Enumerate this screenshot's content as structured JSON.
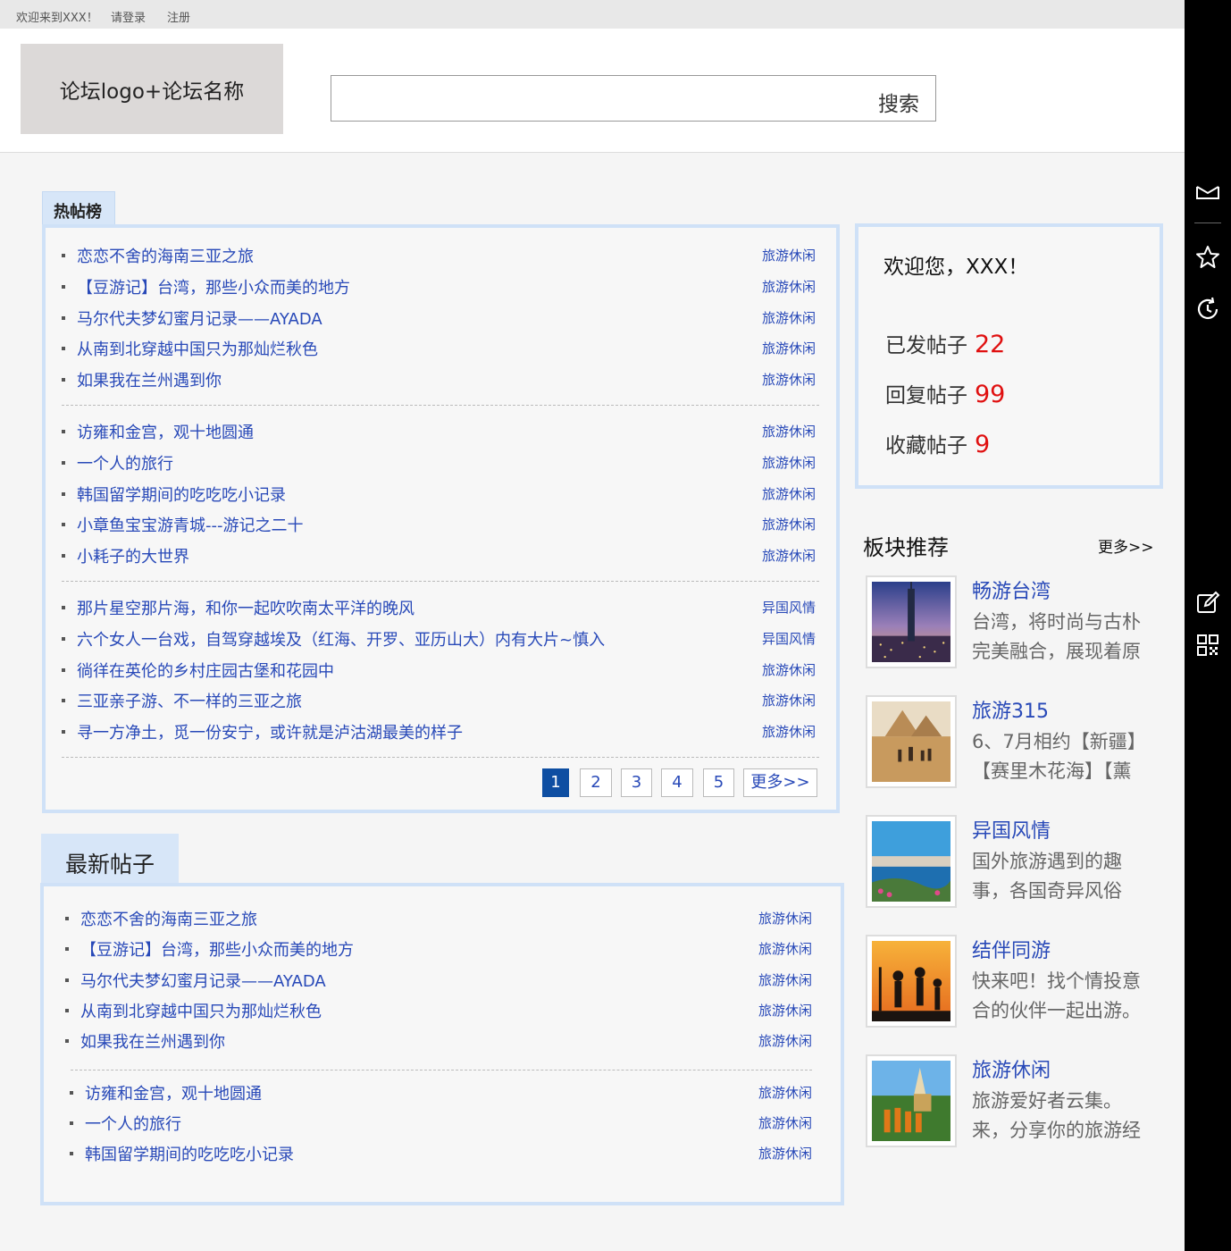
{
  "topbar": {
    "welcome": "欢迎来到XXX！",
    "login": "请登录",
    "register": "注册"
  },
  "header": {
    "logo_text": "论坛logo+论坛名称",
    "search_button": "搜索"
  },
  "hot": {
    "tab": "热帖榜",
    "groups": [
      [
        {
          "title": "恋恋不舍的海南三亚之旅",
          "tag": "旅游休闲"
        },
        {
          "title": "【豆游记】台湾，那些小众而美的地方",
          "tag": "旅游休闲"
        },
        {
          "title": "马尔代夫梦幻蜜月记录——AYADA",
          "tag": "旅游休闲"
        },
        {
          "title": "从南到北穿越中国只为那灿烂秋色",
          "tag": "旅游休闲"
        },
        {
          "title": "如果我在兰州遇到你",
          "tag": "旅游休闲"
        }
      ],
      [
        {
          "title": "访雍和金宫，观十地圆通",
          "tag": "旅游休闲"
        },
        {
          "title": "一个人的旅行",
          "tag": "旅游休闲"
        },
        {
          "title": "韩国留学期间的吃吃吃小记录",
          "tag": "旅游休闲"
        },
        {
          "title": "小章鱼宝宝游青城---游记之二十",
          "tag": "旅游休闲"
        },
        {
          "title": "小耗子的大世界",
          "tag": "旅游休闲"
        }
      ],
      [
        {
          "title": "那片星空那片海，和你一起吹吹南太平洋的晚风",
          "tag": "异国风情"
        },
        {
          "title": "六个女人一台戏，自驾穿越埃及（红海、开罗、亚历山大）内有大片~慎入",
          "tag": "异国风情"
        },
        {
          "title": "徜徉在英伦的乡村庄园古堡和花园中",
          "tag": "旅游休闲"
        },
        {
          "title": "三亚亲子游、不一样的三亚之旅",
          "tag": "旅游休闲"
        },
        {
          "title": "寻一方净土，觅一份安宁，或许就是泸沽湖最美的样子",
          "tag": "旅游休闲"
        }
      ]
    ],
    "pager": {
      "pages": [
        "1",
        "2",
        "3",
        "4",
        "5"
      ],
      "more": "更多>>",
      "current": 1
    }
  },
  "latest": {
    "tab": "最新帖子",
    "groups": [
      [
        {
          "title": "恋恋不舍的海南三亚之旅",
          "tag": "旅游休闲"
        },
        {
          "title": "【豆游记】台湾，那些小众而美的地方",
          "tag": "旅游休闲"
        },
        {
          "title": "马尔代夫梦幻蜜月记录——AYADA",
          "tag": "旅游休闲"
        },
        {
          "title": "从南到北穿越中国只为那灿烂秋色",
          "tag": "旅游休闲"
        },
        {
          "title": "如果我在兰州遇到你",
          "tag": "旅游休闲"
        }
      ],
      [
        {
          "title": "访雍和金宫，观十地圆通",
          "tag": "旅游休闲"
        },
        {
          "title": "一个人的旅行",
          "tag": "旅游休闲"
        },
        {
          "title": "韩国留学期间的吃吃吃小记录",
          "tag": "旅游休闲"
        }
      ]
    ]
  },
  "user": {
    "greeting": "欢迎您，XXX！",
    "stats": [
      {
        "label": "已发帖子",
        "value": "22"
      },
      {
        "label": "回复帖子",
        "value": "99"
      },
      {
        "label": "收藏帖子",
        "value": "9"
      }
    ]
  },
  "recommend": {
    "title": "板块推荐",
    "more": "更多>>",
    "items": [
      {
        "name": "畅游台湾",
        "desc": "台湾，将时尚与古朴完美融合，展现着原",
        "image": "taipei-101-night-photo"
      },
      {
        "name": "旅游315",
        "desc": "6、7月相约【新疆】【赛里木花海】【薰",
        "image": "pyramids-camels-photo"
      },
      {
        "name": "异国风情",
        "desc": "国外旅游遇到的趣事，各国奇异风俗",
        "image": "coastal-town-photo"
      },
      {
        "name": "结伴同游",
        "desc": "快来吧！找个情投意合的伙伴一起出游。",
        "image": "sunset-dancing-silhouettes-photo"
      },
      {
        "name": "旅游休闲",
        "desc": "旅游爱好者云集。来，分享你的旅游经",
        "image": "temple-monks-photo"
      }
    ]
  },
  "sidebar": {
    "icons": [
      "mail-icon",
      "star-icon",
      "history-icon",
      "edit-icon",
      "qrcode-icon"
    ]
  },
  "colors": {
    "link": "#2849b8",
    "accent_box": "#cfe1f7",
    "tab_bg": "#d7e6f8",
    "stat_number": "#e01010",
    "pager_active": "#0e4ea2"
  }
}
